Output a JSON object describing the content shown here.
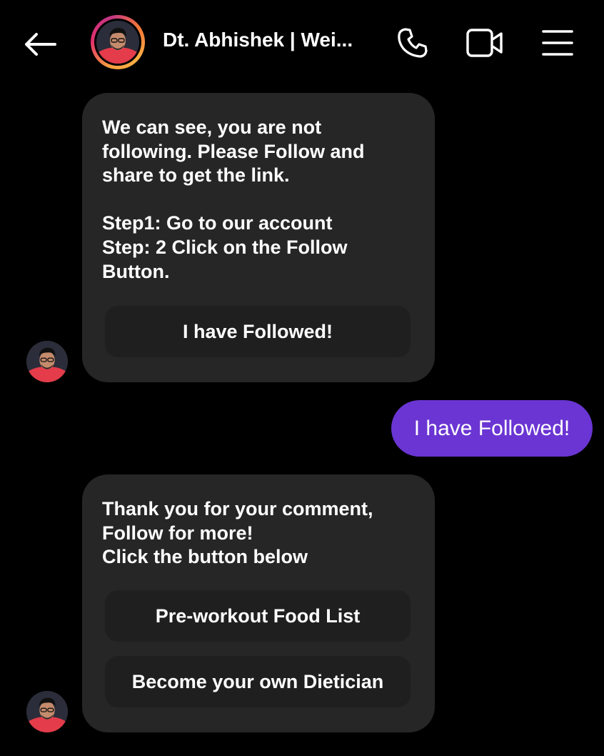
{
  "header": {
    "back_icon": "arrow-left-icon",
    "title": "Dt. Abhishek | Wei...",
    "call_icon": "phone-icon",
    "video_icon": "video-camera-icon",
    "menu_icon": "hamburger-menu-icon",
    "ring_colors": [
      "#f9a03f",
      "#e1306c",
      "#c13584",
      "#fcaf45"
    ]
  },
  "messages": [
    {
      "direction": "incoming",
      "text": "We can see, you are not\nfollowing. Please Follow and\nshare to get the link.\n\nStep1: Go to our account\nStep: 2 Click on the Follow\nButton.",
      "buttons": [
        "I have Followed!"
      ]
    },
    {
      "direction": "outgoing",
      "text": "I have Followed!"
    },
    {
      "direction": "incoming",
      "text": "Thank you for your comment,\nFollow for more!\nClick the button below",
      "buttons": [
        "Pre-workout Food List",
        "Become your own Dietician"
      ]
    }
  ],
  "colors": {
    "background": "#000000",
    "incoming_bubble": "#262626",
    "quick_reply_button": "#1f1f1f",
    "outgoing_bubble": "#6a35d3",
    "text": "#ffffff"
  }
}
